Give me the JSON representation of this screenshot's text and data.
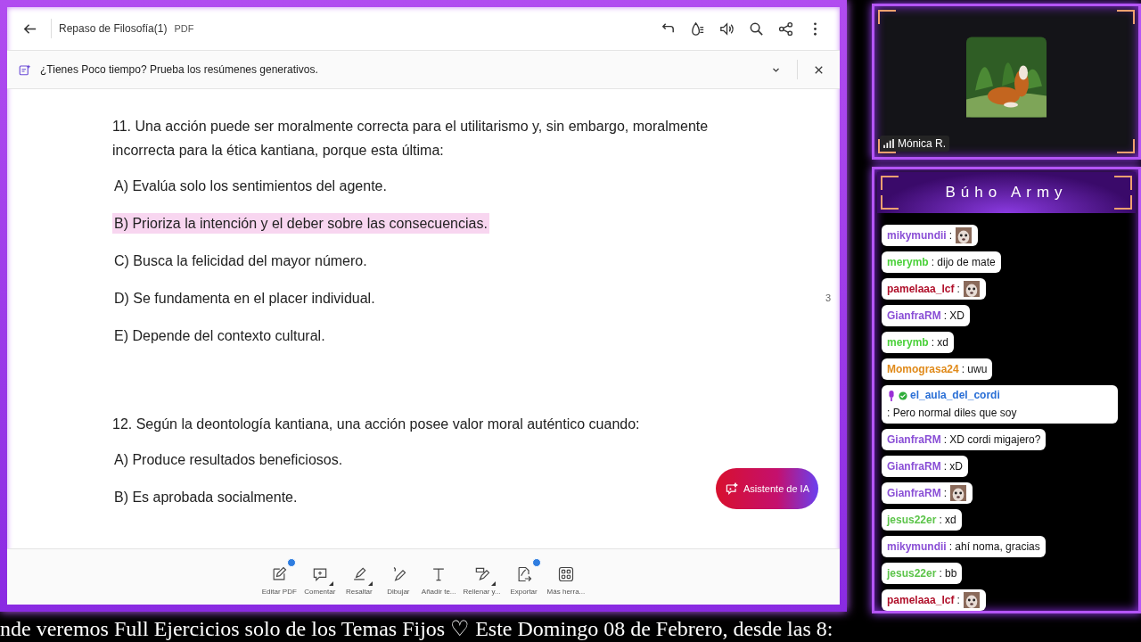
{
  "viewer": {
    "title": "Repaso de Filosofía(1)",
    "file_type": "PDF",
    "banner": "¿Tienes Poco tiempo? Prueba los resúmenes generativos.",
    "page_number": "3",
    "questions": [
      {
        "prompt": "11. Una acción puede ser moralmente correcta para el utilitarismo y, sin embargo, moralmente incorrecta para la ética kantiana, porque esta última:",
        "options": [
          {
            "text": "A) Evalúa solo los sentimientos del agente.",
            "highlighted": false
          },
          {
            "text": "B) Prioriza la intención y el deber sobre las consecuencias.",
            "highlighted": true
          },
          {
            "text": "C) Busca la felicidad del mayor número.",
            "highlighted": false
          },
          {
            "text": "D) Se fundamenta en el placer individual.",
            "highlighted": false
          },
          {
            "text": "E) Depende del contexto cultural.",
            "highlighted": false
          }
        ]
      },
      {
        "prompt": "12. Según la deontología kantiana, una acción posee valor moral auténtico cuando:",
        "options": [
          {
            "text": "A) Produce resultados beneficiosos.",
            "highlighted": false
          },
          {
            "text": "B) Es aprobada socialmente.",
            "highlighted": false
          }
        ]
      }
    ],
    "ai_button": "Asistente de IA",
    "tools": [
      {
        "label": "Editar PDF",
        "badge": true,
        "dropdown": false
      },
      {
        "label": "Comentar",
        "badge": false,
        "dropdown": true
      },
      {
        "label": "Resaltar",
        "badge": false,
        "dropdown": true
      },
      {
        "label": "Dibujar",
        "badge": false,
        "dropdown": false
      },
      {
        "label": "Añadir te...",
        "badge": false,
        "dropdown": false
      },
      {
        "label": "Rellenar y...",
        "badge": false,
        "dropdown": true
      },
      {
        "label": "Exportar",
        "badge": true,
        "dropdown": false
      },
      {
        "label": "Más herra...",
        "badge": false,
        "dropdown": false
      }
    ]
  },
  "camera": {
    "name": "Mónica R."
  },
  "chat": {
    "title": "Búho Army",
    "messages": [
      {
        "user": "mikymundii",
        "color": "#8a4fd6",
        "kind": "emote",
        "text": ":",
        "badges": false
      },
      {
        "user": "merymb",
        "color": "#4bd13a",
        "kind": "text",
        "text": ": dijo de mate",
        "badges": false
      },
      {
        "user": "pamelaaa_lcf",
        "color": "#b0102a",
        "kind": "emote",
        "text": ":",
        "badges": false
      },
      {
        "user": "GianfraRM",
        "color": "#8a4fd6",
        "kind": "text",
        "text": ": XD",
        "badges": false
      },
      {
        "user": "merymb",
        "color": "#4bd13a",
        "kind": "text",
        "text": ": xd",
        "badges": false
      },
      {
        "user": "Momograsa24",
        "color": "#e08a1a",
        "kind": "text",
        "text": ": uwu",
        "badges": false
      },
      {
        "user": "el_aula_del_cordi",
        "color": "#2a6fd6",
        "kind": "text",
        "text": ": Pero normal diles que soy",
        "badges": true
      },
      {
        "user": "GianfraRM",
        "color": "#8a4fd6",
        "kind": "text",
        "text": ": XD cordi migajero?",
        "badges": false
      },
      {
        "user": "GianfraRM",
        "color": "#8a4fd6",
        "kind": "text",
        "text": ": xD",
        "badges": false
      },
      {
        "user": "GianfraRM",
        "color": "#8a4fd6",
        "kind": "emote",
        "text": ":",
        "badges": false
      },
      {
        "user": "jesus22er",
        "color": "#5cc44a",
        "kind": "text",
        "text": ": xd",
        "badges": false
      },
      {
        "user": "mikymundii",
        "color": "#8a4fd6",
        "kind": "text",
        "text": ": ahí noma, gracias",
        "badges": false
      },
      {
        "user": "jesus22er",
        "color": "#5cc44a",
        "kind": "text",
        "text": ": bb",
        "badges": false
      },
      {
        "user": "pamelaaa_lcf",
        "color": "#b0102a",
        "kind": "emote",
        "text": ":",
        "badges": false
      }
    ]
  },
  "ticker": "nde veremos Full Ejercicios solo de los Temas Fijos ♡  Este Domingo 08 de Febrero, desde las 8:"
}
